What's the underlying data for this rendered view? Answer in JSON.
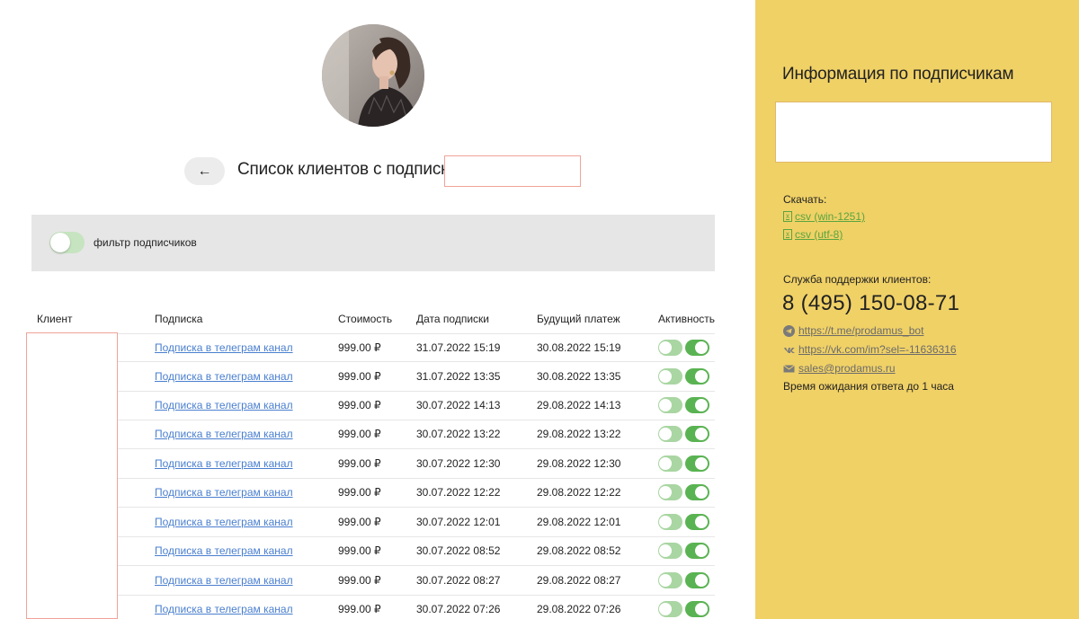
{
  "header": {
    "back_label": "←",
    "title": "Список клиентов с подписками"
  },
  "filter": {
    "label": "фильтр подписчиков",
    "enabled": false
  },
  "table": {
    "columns": [
      "Клиент",
      "Подписка",
      "Стоимость",
      "Дата подписки",
      "Будущий платеж",
      "Активность"
    ],
    "rows": [
      {
        "subscription": "Подписка в телеграм канал",
        "price": "999.00 ₽",
        "date": "31.07.2022 15:19",
        "next_payment": "30.08.2022 15:19"
      },
      {
        "subscription": "Подписка в телеграм канал",
        "price": "999.00 ₽",
        "date": "31.07.2022 13:35",
        "next_payment": "30.08.2022 13:35"
      },
      {
        "subscription": "Подписка в телеграм канал",
        "price": "999.00 ₽",
        "date": "30.07.2022 14:13",
        "next_payment": "29.08.2022 14:13"
      },
      {
        "subscription": "Подписка в телеграм канал",
        "price": "999.00 ₽",
        "date": "30.07.2022 13:22",
        "next_payment": "29.08.2022 13:22"
      },
      {
        "subscription": "Подписка в телеграм канал",
        "price": "999.00 ₽",
        "date": "30.07.2022 12:30",
        "next_payment": "29.08.2022 12:30"
      },
      {
        "subscription": "Подписка в телеграм канал",
        "price": "999.00 ₽",
        "date": "30.07.2022 12:22",
        "next_payment": "29.08.2022 12:22"
      },
      {
        "subscription": "Подписка в телеграм канал",
        "price": "999.00 ₽",
        "date": "30.07.2022 12:01",
        "next_payment": "29.08.2022 12:01"
      },
      {
        "subscription": "Подписка в телеграм канал",
        "price": "999.00 ₽",
        "date": "30.07.2022 08:52",
        "next_payment": "29.08.2022 08:52"
      },
      {
        "subscription": "Подписка в телеграм канал",
        "price": "999.00 ₽",
        "date": "30.07.2022 08:27",
        "next_payment": "29.08.2022 08:27"
      },
      {
        "subscription": "Подписка в телеграм канал",
        "price": "999.00 ₽",
        "date": "30.07.2022 07:26",
        "next_payment": "29.08.2022 07:26"
      }
    ]
  },
  "sidebar": {
    "title": "Информация по подписчикам",
    "download_label": "Скачать:",
    "downloads": [
      {
        "label": "csv (win-1251)",
        "icon": "excel-file-icon"
      },
      {
        "label": "csv (utf-8)",
        "icon": "excel-file-icon"
      }
    ],
    "support_label": "Служба поддержки клиентов:",
    "phone": "8 (495) 150-08-71",
    "links": [
      {
        "label": "https://t.me/prodamus_bot",
        "icon": "telegram-icon"
      },
      {
        "label": "https://vk.com/im?sel=-11636316",
        "icon": "vk-icon"
      },
      {
        "label": "sales@prodamus.ru",
        "icon": "mail-icon"
      }
    ],
    "wait_text": "Время ожидания ответа до 1 часа"
  },
  "colors": {
    "sidebar_bg": "#f0d166",
    "link": "#4a7fcf",
    "download_link": "#5aa43f",
    "toggle_on": "#5ab352",
    "toggle_light": "#a9d6a2",
    "filter_bg": "#e6e6e6",
    "redaction_border": "#f0a39a"
  }
}
